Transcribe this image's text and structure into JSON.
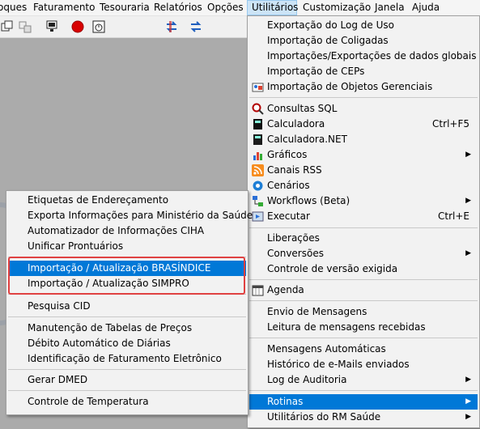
{
  "menubar": {
    "items": [
      "oques",
      "Faturamento",
      "Tesouraria",
      "Relatórios",
      "Opções",
      "Utilitários",
      "Customização",
      "Janela",
      "Ajuda"
    ]
  },
  "toolbar": {
    "icons": [
      "copy-icon",
      "windows-icon",
      "monitor-icon",
      "record-icon",
      "stopwatch-icon",
      "swap-icon",
      "sync-icon"
    ]
  },
  "utilitarios_menu": {
    "items": [
      {
        "label": "Exportação do Log de Uso"
      },
      {
        "label": "Importação de Coligadas"
      },
      {
        "label": "Importações/Exportações de dados globais"
      },
      {
        "label": "Importação de CEPs"
      },
      {
        "label": "Importação de Objetos Gerenciais"
      },
      {
        "label": "Consultas SQL"
      },
      {
        "label": "Calculadora",
        "shortcut": "Ctrl+F5"
      },
      {
        "label": "Calculadora.NET"
      },
      {
        "label": "Gráficos"
      },
      {
        "label": "Canais RSS"
      },
      {
        "label": "Cenários"
      },
      {
        "label": "Workflows (Beta)"
      },
      {
        "label": "Executar",
        "shortcut": "Ctrl+E"
      },
      {
        "label": "Liberações"
      },
      {
        "label": "Conversões"
      },
      {
        "label": "Controle de versão exigida"
      },
      {
        "label": "Agenda"
      },
      {
        "label": "Envio de Mensagens"
      },
      {
        "label": "Leitura de mensagens recebidas"
      },
      {
        "label": "Mensagens Automáticas"
      },
      {
        "label": "Histórico de e-Mails enviados"
      },
      {
        "label": "Log de Auditoria"
      },
      {
        "label": "Rotinas"
      },
      {
        "label": "Utilitários do RM Saúde"
      }
    ]
  },
  "rotinas_submenu": {
    "items": [
      {
        "label": "Etiquetas de Endereçamento"
      },
      {
        "label": "Exporta Informações para Ministério da Saúde"
      },
      {
        "label": "Automatizador de Informações CIHA"
      },
      {
        "label": "Unificar Prontuários"
      },
      {
        "label": "Importação / Atualização BRASÍNDICE"
      },
      {
        "label": "Importação / Atualização SIMPRO"
      },
      {
        "label": "Pesquisa CID"
      },
      {
        "label": "Manutenção de Tabelas de Preços"
      },
      {
        "label": "Débito Automático de Diárias"
      },
      {
        "label": "Identificação de Faturamento Eletrônico"
      },
      {
        "label": "Gerar DMED"
      },
      {
        "label": "Controle de Temperatura"
      }
    ]
  },
  "colors": {
    "highlight": "#0078d7",
    "annotation": "#e04141",
    "menubar_active": "#cce4f7"
  }
}
